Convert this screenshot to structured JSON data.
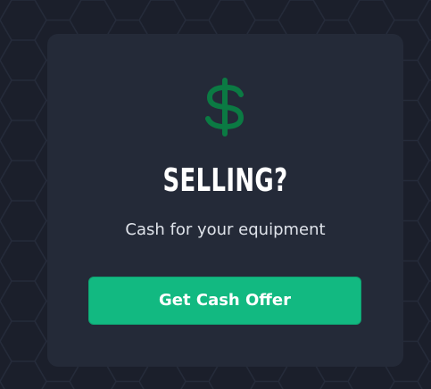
{
  "card": {
    "icon": "dollar-sign-icon",
    "title": "SELLING?",
    "subtitle": "Cash for your equipment",
    "button_label": "Get Cash Offer"
  },
  "colors": {
    "background": "#1b1f2b",
    "card_background": "#242a38",
    "icon_green": "#0b7a43",
    "button_green": "#12b981",
    "title_text": "#ffffff",
    "subtitle_text": "#dfe3ea"
  }
}
